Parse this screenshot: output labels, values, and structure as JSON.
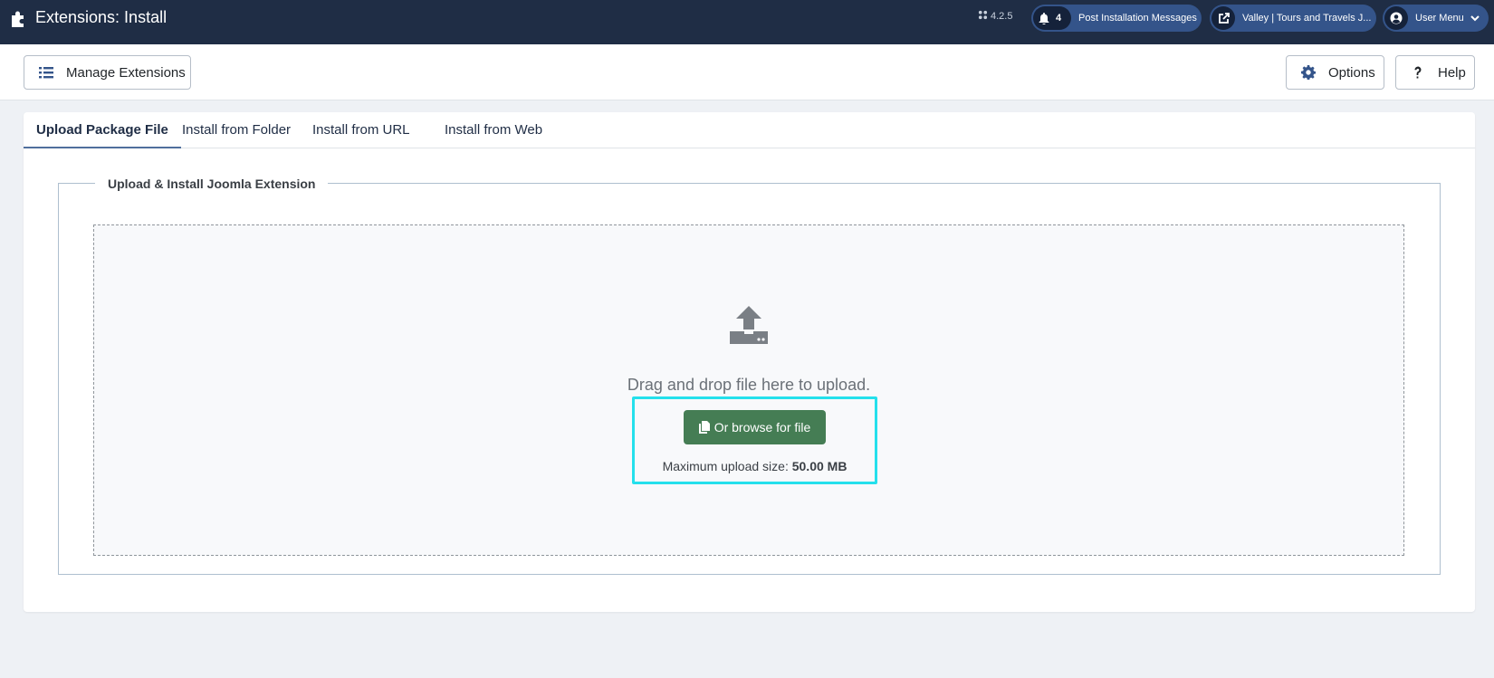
{
  "header": {
    "title": "Extensions: Install",
    "version": "4.2.5",
    "notifications": {
      "count": "4",
      "label": "Post Installation Messages"
    },
    "site_link": "Valley | Tours and Travels J...",
    "user_menu": "User Menu",
    "background_color": "#1f2d45",
    "pill_color": "#34548a"
  },
  "toolbar": {
    "manage_label": "Manage Extensions",
    "options_label": "Options",
    "help_label": "Help"
  },
  "tabs": [
    {
      "label": "Upload Package File",
      "active": true
    },
    {
      "label": "Install from Folder",
      "active": false
    },
    {
      "label": "Install from URL",
      "active": false
    },
    {
      "label": "Install from Web",
      "active": false
    }
  ],
  "upload": {
    "legend": "Upload & Install Joomla Extension",
    "drag_text": "Drag and drop file here to upload.",
    "browse_label": "Or browse for file",
    "max_label": "Maximum upload size:",
    "max_value": "50.00 MB",
    "button_color": "#457d54",
    "highlight_color": "#24e0ec"
  },
  "icons": {
    "page": "puzzle-icon",
    "version": "joomla-icon",
    "notify": "bell-icon",
    "site": "external-link-icon",
    "user": "user-circle-icon",
    "user_chevron": "chevron-down-icon",
    "manage": "list-icon",
    "options": "gear-icon",
    "help": "question-icon",
    "upload": "upload-icon",
    "browse": "copy-icon"
  }
}
